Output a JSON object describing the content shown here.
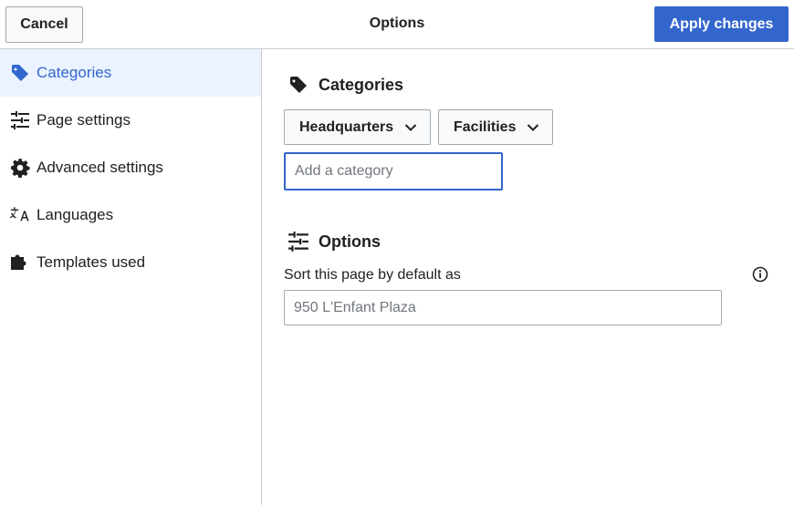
{
  "header": {
    "cancel_label": "Cancel",
    "title": "Options",
    "apply_label": "Apply changes"
  },
  "sidebar": {
    "items": [
      {
        "label": "Categories",
        "icon": "tag-icon",
        "active": true
      },
      {
        "label": "Page settings",
        "icon": "settings-sliders-icon",
        "active": false
      },
      {
        "label": "Advanced settings",
        "icon": "gear-icon",
        "active": false
      },
      {
        "label": "Languages",
        "icon": "language-icon",
        "active": false
      },
      {
        "label": "Templates used",
        "icon": "puzzle-icon",
        "active": false
      }
    ]
  },
  "categories": {
    "heading": "Categories",
    "chips": [
      {
        "label": "Headquarters"
      },
      {
        "label": "Facilities"
      }
    ],
    "add_placeholder": "Add a category"
  },
  "options": {
    "heading": "Options",
    "sort_label": "Sort this page by default as",
    "sort_placeholder": "950 L'Enfant Plaza"
  },
  "colors": {
    "accent": "#3366cc",
    "active_bg": "#eaf3ff",
    "border": "#c8ccd1",
    "text": "#202122",
    "placeholder": "#72777d"
  }
}
